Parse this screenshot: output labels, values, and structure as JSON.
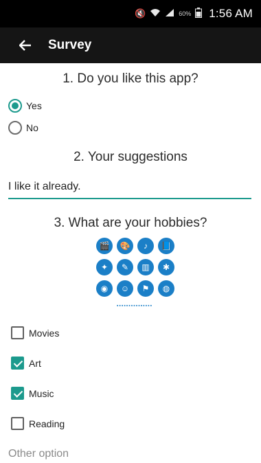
{
  "status_bar": {
    "mute_icon": "mute-icon",
    "wifi_icon": "wifi-icon",
    "signal_icon": "signal-icon",
    "battery_text": "60%",
    "battery_icon": "battery-icon",
    "time": "1:56 AM"
  },
  "app_bar": {
    "back_icon": "back-arrow-icon",
    "title": "Survey"
  },
  "questions": {
    "q1": "1. Do you like this app?",
    "q2": "2. Your suggestions",
    "q3": "3. What are your hobbies?"
  },
  "q1_options": [
    {
      "label": "Yes",
      "selected": true
    },
    {
      "label": "No",
      "selected": false
    }
  ],
  "suggestion_value": "I like it already.",
  "hobby_image": {
    "description_icons": [
      "movie-icon",
      "palette-icon",
      "music-icon",
      "book-icon",
      "gamepad-icon",
      "brush-icon",
      "open-book-icon",
      "network-icon",
      "camera-icon",
      "drama-icon",
      "sports-icon",
      "globe-icon"
    ]
  },
  "hobbies": [
    {
      "label": "Movies",
      "checked": false
    },
    {
      "label": "Art",
      "checked": true
    },
    {
      "label": "Music",
      "checked": true
    },
    {
      "label": "Reading",
      "checked": false
    }
  ],
  "other_option_placeholder": "Other option",
  "colors": {
    "accent": "#1c9a8d",
    "app_bar": "#151515",
    "status_bar": "#000000",
    "hobby_icons": "#1b7fc7"
  }
}
